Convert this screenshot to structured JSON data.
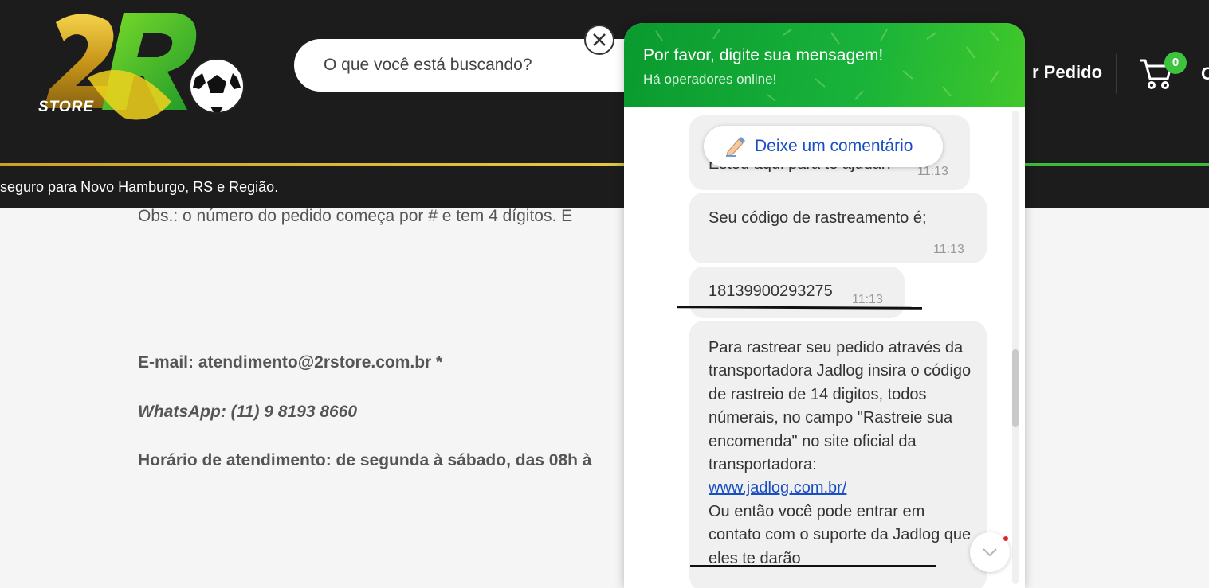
{
  "header": {
    "logo_text": "STORE",
    "search_placeholder": "O que você está buscando?",
    "order_link": "r Pedido",
    "cart_count": "0",
    "trailing_text": "C",
    "announcement": "seguro para Novo Hamburgo, RS e Região."
  },
  "page": {
    "obs": "Obs.: o número do pedido começa por # e tem 4 dígitos. E",
    "email": "E-mail: atendimento@2rstore.com.br *",
    "whatsapp": "WhatsApp: (11) 9 8193 8660",
    "hours": "Horário de atendimento: de segunda à sábado, das 08h à"
  },
  "chat": {
    "title": "Por favor, digite sua mensagem!",
    "subtitle": "Há operadores online!",
    "comment_button": "Deixe um comentário",
    "messages": [
      {
        "text": "Estou aqui para te ajudar!",
        "time": "11:13"
      },
      {
        "text": "Seu código de rastreamento é;",
        "time": "11:13"
      },
      {
        "text": "18139900293275",
        "time": "11:13"
      },
      {
        "text_before": "Para rastrear seu pedido através da transportadora Jadlog insira o código de rastreio de 14 digitos, todos númerais, no campo \"Rastreie sua encomenda\" no site oficial da transportadora:",
        "link": "www.jadlog.com.br/",
        "text_after": "Ou então você pode entrar em contato com o suporte da Jadlog que eles te darão"
      }
    ]
  },
  "colors": {
    "header_bg": "#1c1c1c",
    "chat_header_green": "#19b33a",
    "link_blue": "#1a4fc2",
    "badge_green": "#3dc33d"
  }
}
